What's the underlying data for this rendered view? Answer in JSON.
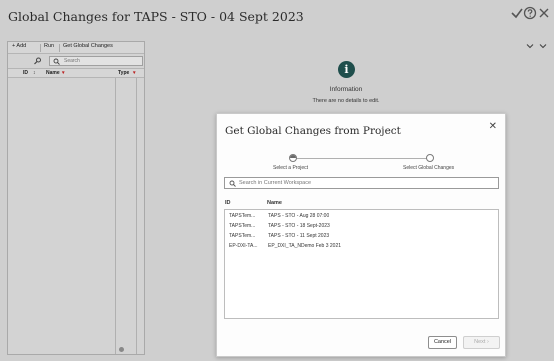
{
  "page": {
    "title": "Global Changes for TAPS - STO - 04 Sept 2023"
  },
  "header_icons": {
    "confirm": "checkmark-icon",
    "help": "help-icon",
    "close": "close-icon"
  },
  "left_panel": {
    "toolbar": {
      "add_label": "+ Add",
      "run_label": "Run",
      "get_label": "Get Global Changes"
    },
    "search": {
      "placeholder": "Search"
    },
    "columns": {
      "id": "ID",
      "name": "Name",
      "type": "Type"
    },
    "sort_glyph": "↕",
    "filter_glyph": "▾"
  },
  "info": {
    "glyph": "i",
    "title": "Information",
    "text": "There are no details to edit."
  },
  "dialog": {
    "title": "Get Global Changes from Project",
    "close_glyph": "✕",
    "train": {
      "step1": "Select a Project",
      "step2": "Select Global Changes"
    },
    "search": {
      "placeholder": "Search in Current Workspace"
    },
    "columns": {
      "id": "ID",
      "name": "Name"
    },
    "rows": [
      {
        "id": "TAPSTem...",
        "name": "TAPS - STO - Aug 28 07:00"
      },
      {
        "id": "TAPSTem...",
        "name": "TAPS - STO - 18 Sept-2023"
      },
      {
        "id": "TAPSTem...",
        "name": "TAPS - STO - 11 Sept 2023"
      },
      {
        "id": "EP-DXI-TA...",
        "name": "EP_DXI_TA_NDemo Feb 3 2021"
      }
    ],
    "buttons": {
      "cancel": "Cancel",
      "next": "Next",
      "next_glyph": "›"
    }
  },
  "colors": {
    "info_icon_bg": "#1f4e4c",
    "backdrop": "#cfcfcf"
  }
}
